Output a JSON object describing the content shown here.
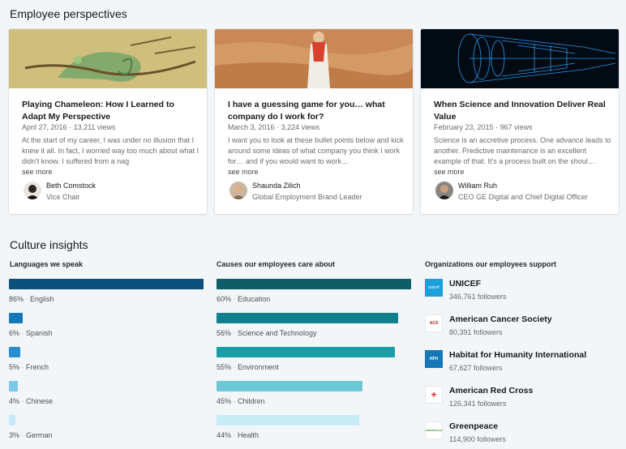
{
  "sections": {
    "perspectives_title": "Employee perspectives",
    "culture_title": "Culture insights"
  },
  "cards": [
    {
      "title": "Playing Chameleon: How I Learned to Adapt My Perspective",
      "date": "April 27, 2016",
      "views": "13,211 views",
      "excerpt": "At the start of my career, I was under no illusion that I knew it all. In fact, I worried way too much about what I didn't know. I suffered from a nag",
      "more": "see more",
      "author": "Beth Comstock",
      "role": "Vice Chair"
    },
    {
      "title": "I have a guessing game for you… what company do I work for?",
      "date": "March 3, 2016",
      "views": "3,224 views",
      "excerpt": "I want you to look at these bullet points below and kick around some ideas of what company you think I work for… and if you would want to work…",
      "more": "see more",
      "author": "Shaunda Zilich",
      "role": "Global Employment Brand Leader"
    },
    {
      "title": "When Science and Innovation Deliver Real Value",
      "date": "February 23, 2015",
      "views": "967 views",
      "excerpt": "Science is an accretive process. One advance leads to another. Predictive maintenance is an excellent example of that. It's a process built on the shoul…",
      "more": "see more",
      "author": "William Ruh",
      "role": "CEO GE Digital and Chief Digital Officer"
    }
  ],
  "languages": {
    "heading": "Languages we speak",
    "items": [
      {
        "pct": "86%",
        "label": "English",
        "value": 86
      },
      {
        "pct": "6%",
        "label": "Spanish",
        "value": 6
      },
      {
        "pct": "5%",
        "label": "French",
        "value": 5
      },
      {
        "pct": "4%",
        "label": "Chinese",
        "value": 4
      },
      {
        "pct": "3%",
        "label": "German",
        "value": 3
      }
    ]
  },
  "causes": {
    "heading": "Causes our employees care about",
    "items": [
      {
        "pct": "60%",
        "label": "Education",
        "value": 60
      },
      {
        "pct": "56%",
        "label": "Science and Technology",
        "value": 56
      },
      {
        "pct": "55%",
        "label": "Environment",
        "value": 55
      },
      {
        "pct": "45%",
        "label": "Children",
        "value": 45
      },
      {
        "pct": "44%",
        "label": "Health",
        "value": 44
      }
    ]
  },
  "organizations": {
    "heading": "Organizations our employees support",
    "items": [
      {
        "name": "UNICEF",
        "followers": "346,761 followers",
        "logo_text": "unicef"
      },
      {
        "name": "American Cancer Society",
        "followers": "80,391 followers",
        "logo_text": "ACS"
      },
      {
        "name": "Habitat for Humanity International",
        "followers": "67,627 followers",
        "logo_text": "HFH"
      },
      {
        "name": "American Red Cross",
        "followers": "126,341 followers",
        "logo_text": "+"
      },
      {
        "name": "Greenpeace",
        "followers": "114,900 followers",
        "logo_text": "GREENPEACE"
      }
    ]
  },
  "separator": "·",
  "colors": {
    "lang_bars": [
      "#0b4f7c",
      "#1478b8",
      "#2a8fd0",
      "#7cc8ec",
      "#c6e8f7"
    ],
    "cause_bars": [
      "#0e5c66",
      "#10808c",
      "#1a9ea6",
      "#6ec7d6",
      "#c8ecf3"
    ]
  }
}
